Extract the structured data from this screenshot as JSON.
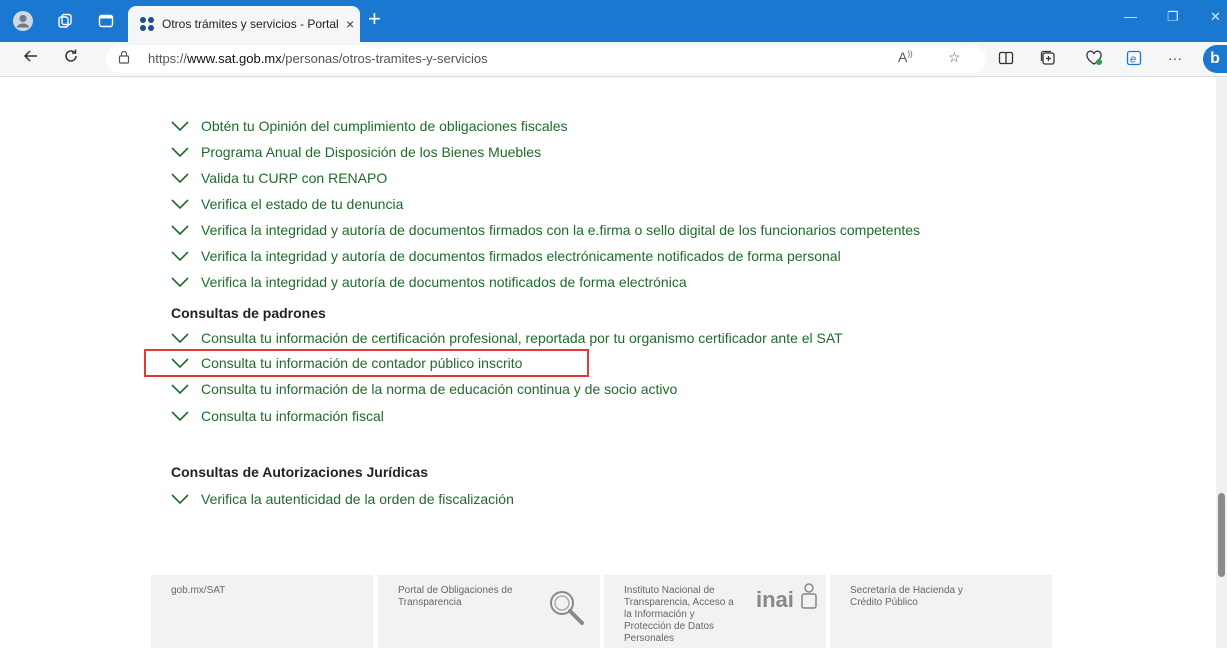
{
  "browser": {
    "tab_title": "Otros trámites y servicios - Portal",
    "tab_close": "×",
    "new_tab": "+",
    "url_prefix": "https://",
    "url_domain": "www.sat.gob.mx",
    "url_path": "/personas/otros-tramites-y-servicios",
    "window_controls": [
      "—",
      "❐",
      "✕"
    ],
    "toolbar_icons": [
      "split-screen-icon",
      "collections-icon",
      "browser-essentials-icon",
      "edge-icon",
      "more-icon"
    ]
  },
  "content": {
    "items_top": [
      "Obtén tu Opinión del cumplimiento de obligaciones fiscales",
      "Programa Anual de Disposición de los Bienes Muebles",
      "Valida tu CURP con RENAPO",
      "Verifica el estado de tu denuncia",
      "Verifica la integridad y autoría de documentos firmados con la e.firma o sello digital de los funcionarios competentes",
      "Verifica la integridad y autoría de documentos firmados electrónicamente notificados de forma personal",
      "Verifica la integridad y autoría de documentos notificados de forma electrónica"
    ],
    "section_padrones": "Consultas de padrones",
    "items_padrones": [
      "Consulta tu información de certificación profesional, reportada por tu organismo certificador ante el SAT",
      "Consulta tu información de contador público inscrito",
      "Consulta tu información de la norma de educación continua y de socio activo",
      "Consulta tu información fiscal"
    ],
    "section_juridicas": "Consultas de Autorizaciones Jurídicas",
    "items_juridicas": [
      "Verifica la autenticidad de la orden de fiscalización"
    ]
  },
  "footer": {
    "cards": [
      {
        "text": "gob.mx/SAT"
      },
      {
        "text": "Portal de Obligaciones de Transparencia",
        "icon": "magnifier-icon"
      },
      {
        "text": "Instituto Nacional de Transparencia, Acceso a la Información y Protección de Datos Personales",
        "logo": "inai"
      },
      {
        "text": "Secretaría de Hacienda y Crédito Público"
      }
    ]
  },
  "colors": {
    "titlebar": "#1b78d0",
    "link_green": "#1f6b2b",
    "highlight": "#e53935"
  }
}
